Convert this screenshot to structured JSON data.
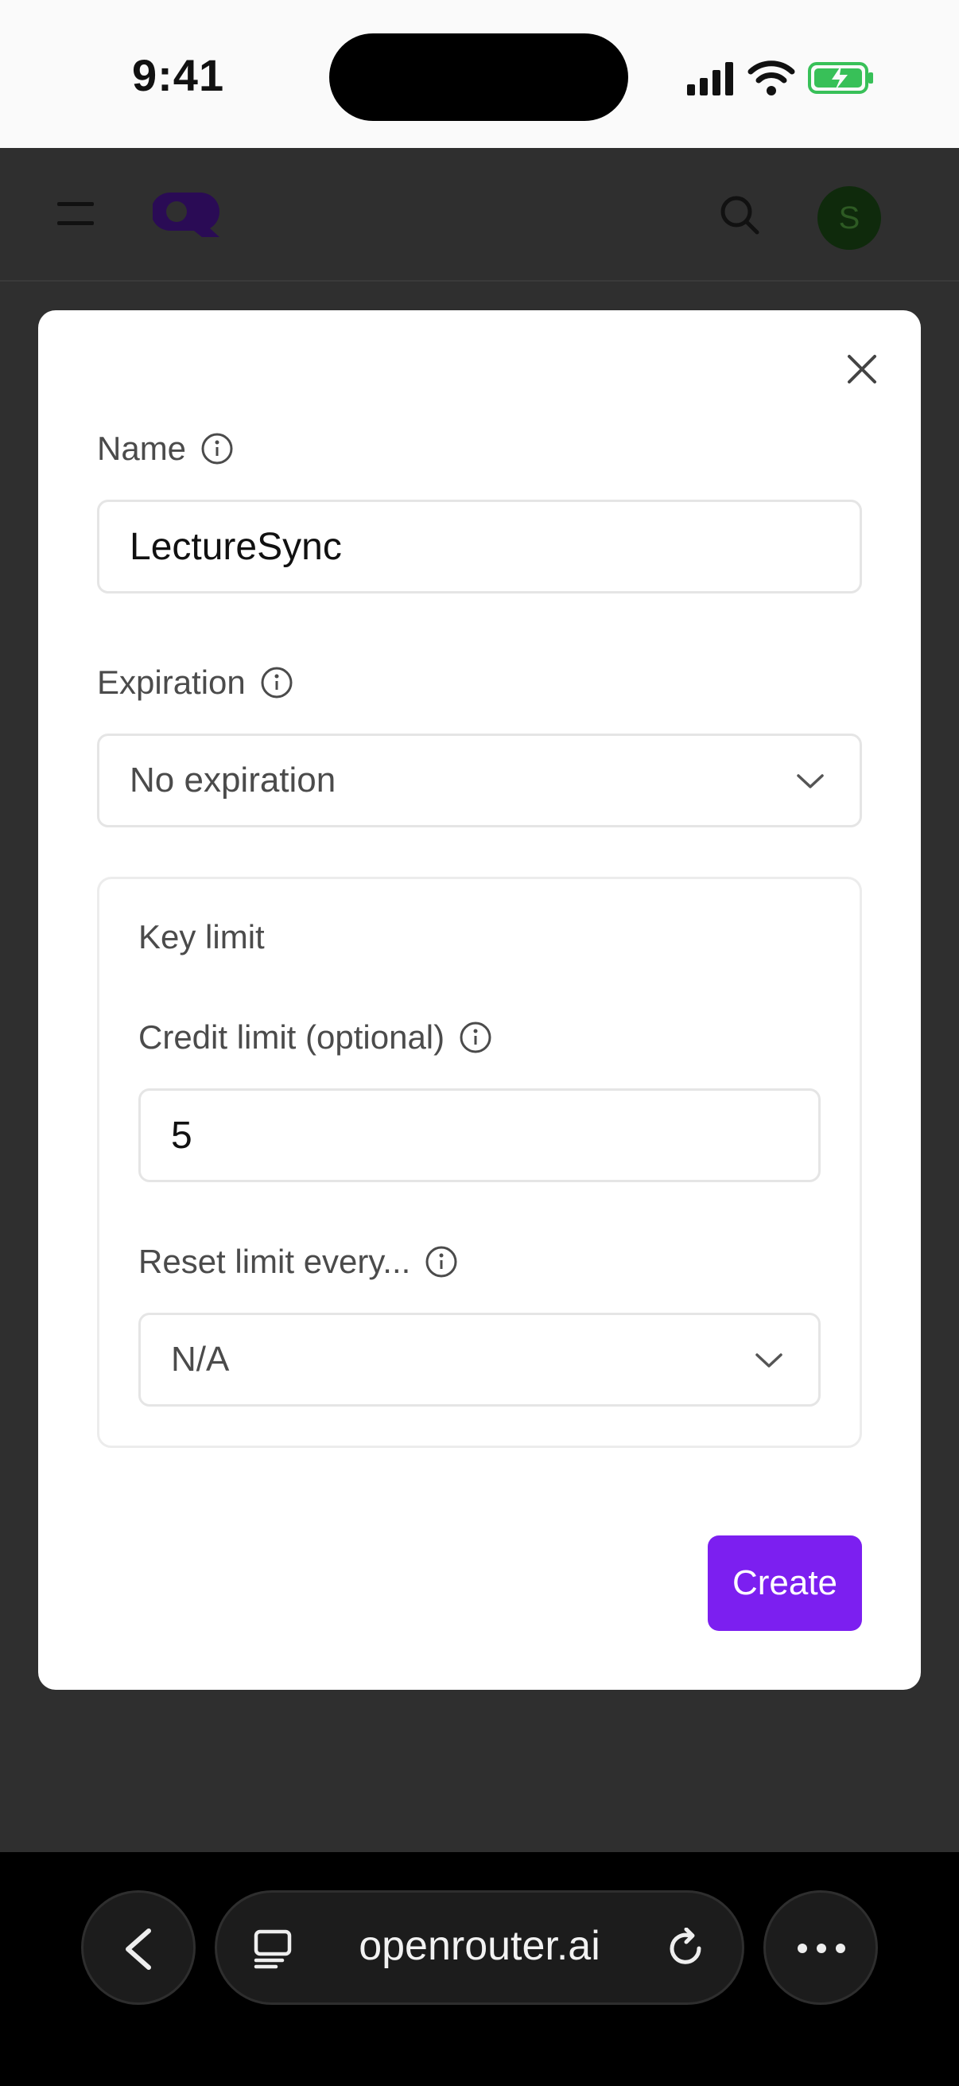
{
  "status_bar": {
    "time": "9:41"
  },
  "modal": {
    "name": {
      "label": "Name",
      "value": "LectureSync"
    },
    "expiration": {
      "label": "Expiration",
      "selected": "No expiration"
    },
    "key_limit": {
      "title": "Key limit",
      "credit_limit": {
        "label": "Credit limit (optional)",
        "value": "5"
      },
      "reset_limit": {
        "label": "Reset limit every...",
        "selected": "N/A"
      }
    },
    "create_label": "Create"
  },
  "header": {
    "avatar_initial": "S"
  },
  "browser": {
    "url": "openrouter.ai"
  },
  "colors": {
    "accent": "#7c1ff0",
    "backdrop": "#2f2f2f",
    "avatar": "#0f2a0c"
  },
  "icons": [
    "menu-icon",
    "logo-icon",
    "search-icon",
    "close-icon",
    "info-icon",
    "chevron-down-icon",
    "back-icon",
    "tabs-icon",
    "reload-icon",
    "more-icon"
  ]
}
